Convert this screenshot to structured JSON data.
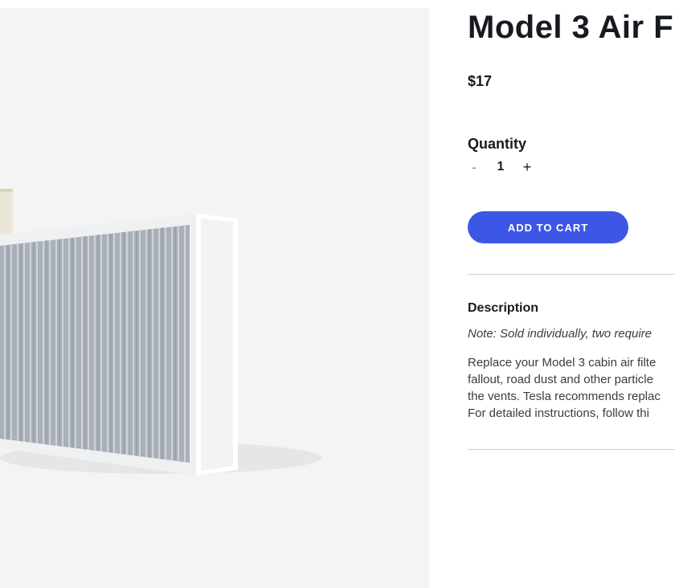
{
  "product": {
    "title": "Model 3 Air F",
    "price": "$17",
    "image_icon": "cabin-air-filter-image"
  },
  "quantity": {
    "label": "Quantity",
    "decrement_label": "-",
    "value": "1",
    "increment_label": "+"
  },
  "cart": {
    "add_label": "ADD TO CART",
    "button_color": "#3e56e6"
  },
  "description": {
    "heading": "Description",
    "note": "Note: Sold individually, two require",
    "lines": [
      "Replace your Model 3 cabin air filte",
      "fallout, road dust and other particle",
      "the vents. Tesla recommends replac",
      "For detailed instructions, follow thi"
    ]
  }
}
